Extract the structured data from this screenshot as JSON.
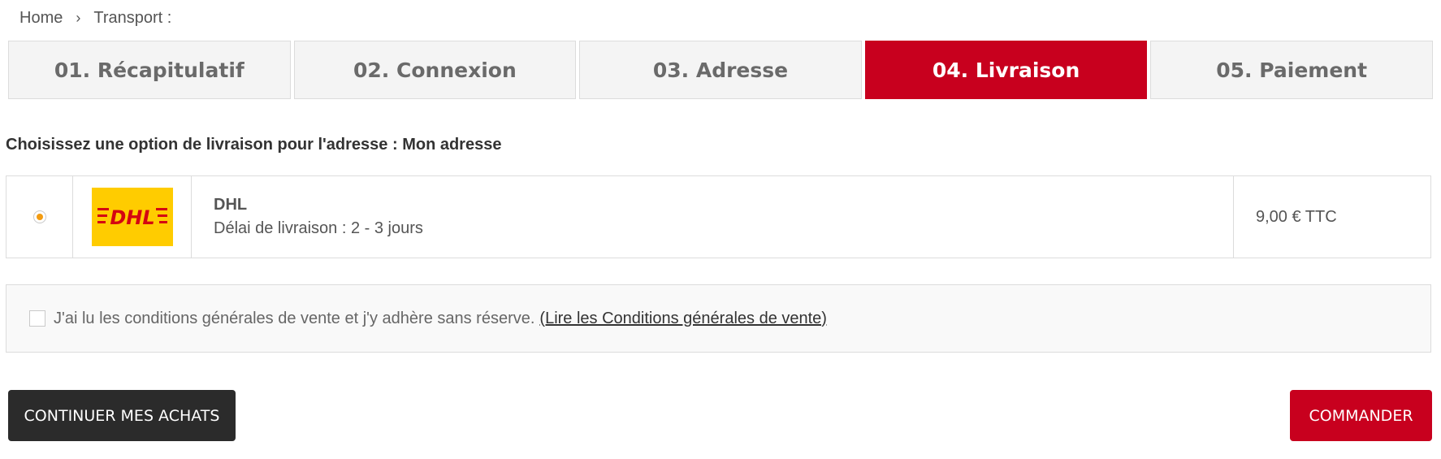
{
  "breadcrumb": {
    "home": "Home",
    "separator": "›",
    "current": "Transport :"
  },
  "steps": [
    {
      "label": "01. Récapitulatif",
      "active": false
    },
    {
      "label": "02. Connexion",
      "active": false
    },
    {
      "label": "03. Adresse",
      "active": false
    },
    {
      "label": "04. Livraison",
      "active": true
    },
    {
      "label": "05. Paiement",
      "active": false
    }
  ],
  "delivery": {
    "heading": "Choisissez une option de livraison pour l'adresse : Mon adresse",
    "carrier": {
      "selected": true,
      "logo_text": "DHL",
      "name": "DHL",
      "delay": "Délai de livraison : 2 - 3 jours",
      "price": "9,00 € TTC"
    }
  },
  "terms": {
    "checked": false,
    "text": "J'ai lu les conditions générales de vente et j'y adhère sans réserve.",
    "link": "(Lire les Conditions générales de vente)"
  },
  "buttons": {
    "continue": "CONTINUER MES ACHATS",
    "order": "COMMANDER"
  },
  "colors": {
    "accent": "#c8001e",
    "dark_button": "#2b2b2b",
    "dhl_yellow": "#ffcc00",
    "dhl_red": "#d40511",
    "radio_dot": "#f39c12"
  }
}
